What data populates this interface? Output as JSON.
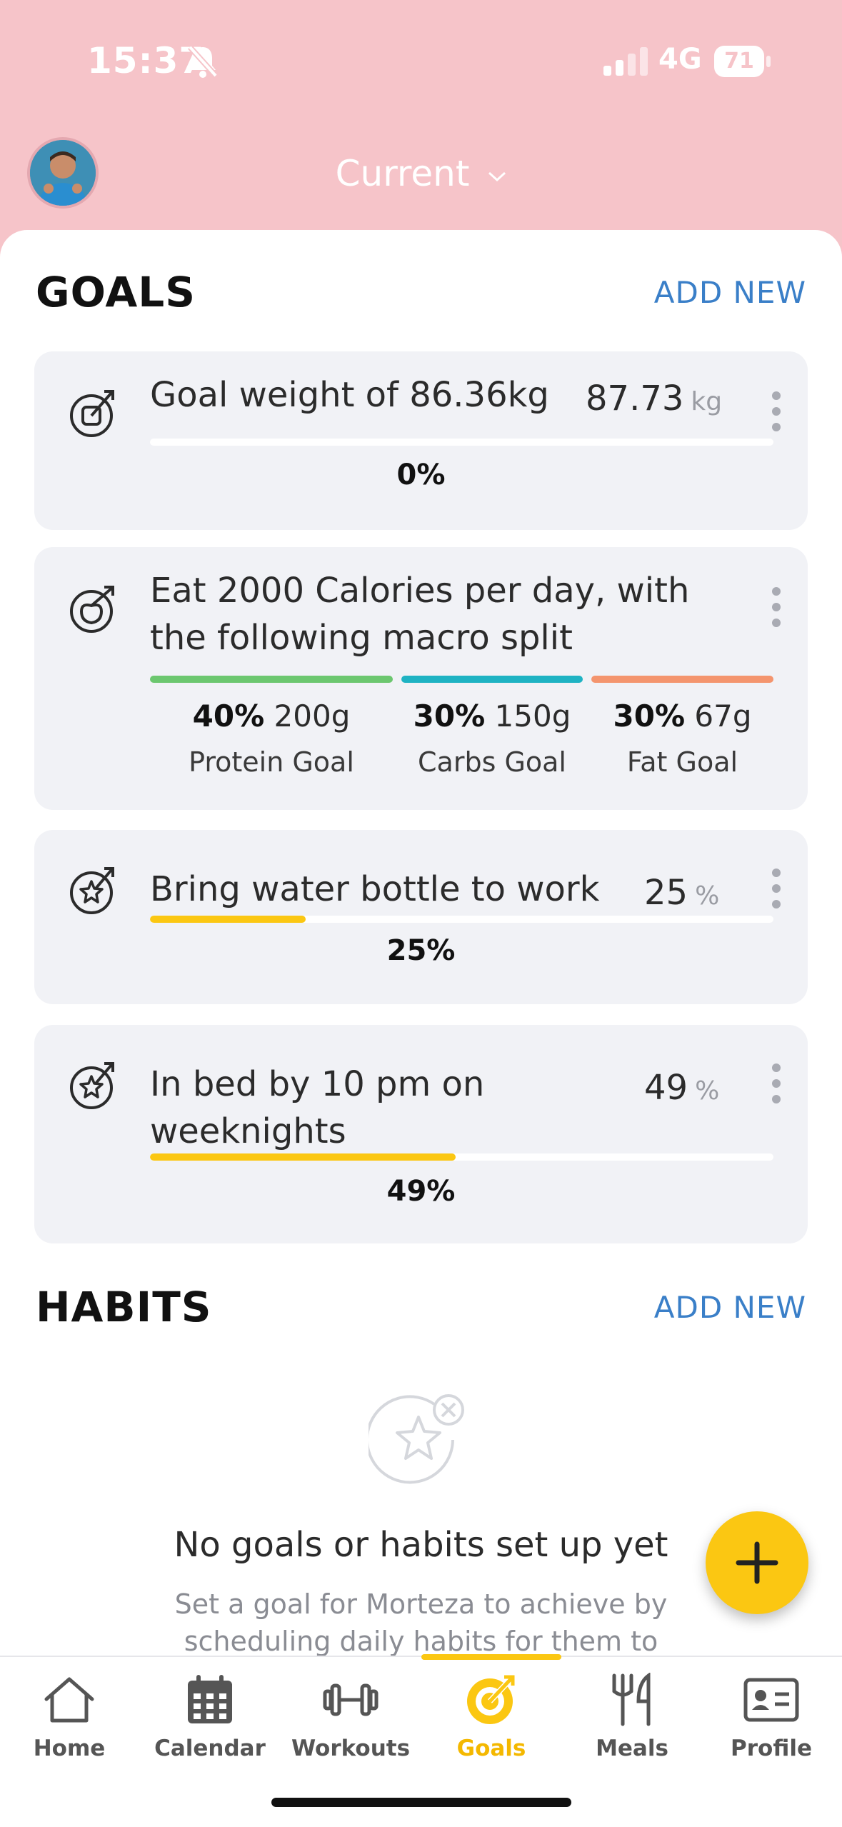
{
  "status_bar": {
    "time": "15:37",
    "network": "4G",
    "battery": "71",
    "battery_level": 0.71
  },
  "header": {
    "title": "Current"
  },
  "goals_section": {
    "title": "GOALS",
    "add_new": "ADD NEW",
    "goals": [
      {
        "text": "Goal weight of 86.36kg",
        "value": "87.73",
        "unit": "kg",
        "percent_label": "0%",
        "progress": 0
      },
      {
        "text": "Eat 2000 Calories per day, with the following macro split",
        "macros": [
          {
            "percent": "40%",
            "grams": "200g",
            "name": "Protein Goal",
            "color": "#6cc76f"
          },
          {
            "percent": "30%",
            "grams": "150g",
            "name": "Carbs Goal",
            "color": "#1fb3c3"
          },
          {
            "percent": "30%",
            "grams": "67g",
            "name": "Fat Goal",
            "color": "#f4956e"
          }
        ]
      },
      {
        "text": "Bring water bottle to work",
        "value": "25",
        "unit": "%",
        "percent_label": "25%",
        "progress": 0.25
      },
      {
        "text": "In bed by 10 pm on weeknights",
        "value": "49",
        "unit": "%",
        "percent_label": "49%",
        "progress": 0.49
      }
    ]
  },
  "habits_section": {
    "title": "HABITS",
    "add_new": "ADD NEW",
    "empty_title": "No goals or habits set up yet",
    "empty_description": "Set a goal for Morteza to achieve by scheduling daily habits for them to"
  },
  "fab": {
    "icon": "plus-icon"
  },
  "tabs": [
    {
      "label": "Home",
      "icon": "home-icon"
    },
    {
      "label": "Calendar",
      "icon": "calendar-icon"
    },
    {
      "label": "Workouts",
      "icon": "dumbbell-icon"
    },
    {
      "label": "Goals",
      "icon": "target-icon",
      "active": true
    },
    {
      "label": "Meals",
      "icon": "fork-knife-icon"
    },
    {
      "label": "Profile",
      "icon": "id-card-icon"
    }
  ],
  "colors": {
    "header_bg": "#f6c4c9",
    "accent": "#fbc712",
    "link": "#3a7fc8",
    "card_bg": "#f1f2f6"
  }
}
